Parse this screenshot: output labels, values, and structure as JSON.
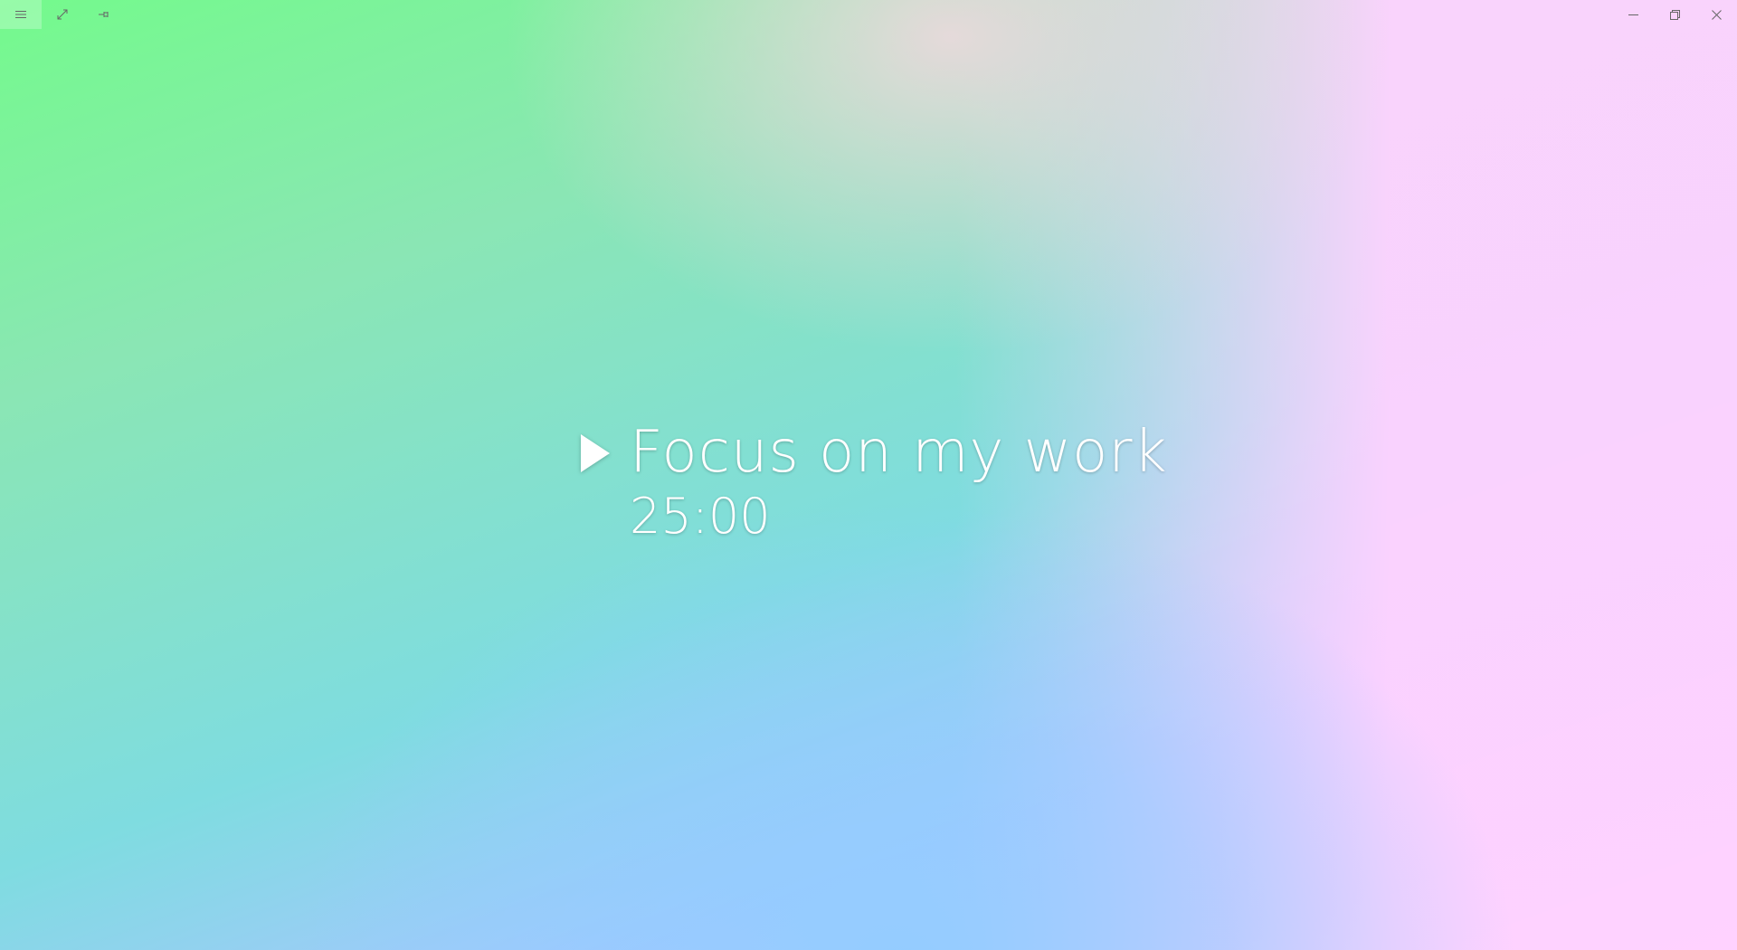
{
  "window": {
    "controls": {
      "menu_icon": "hamburger-menu-icon",
      "expand_icon": "expand-diagonal-icon",
      "pin_icon": "pin-icon",
      "minimize_icon": "minimize-icon",
      "restore_icon": "restore-icon",
      "close_icon": "close-icon"
    }
  },
  "timer": {
    "task_title": "Focus on my work",
    "time_remaining": "25:00",
    "play_icon": "play-icon"
  },
  "colors": {
    "text": "#ffffff",
    "icon": "#666666",
    "background_top_left": "#74fa8c",
    "background_bottom_left": "#37f0b4",
    "background_bottom_center": "#91cdff",
    "background_right": "#ffd0ff"
  }
}
